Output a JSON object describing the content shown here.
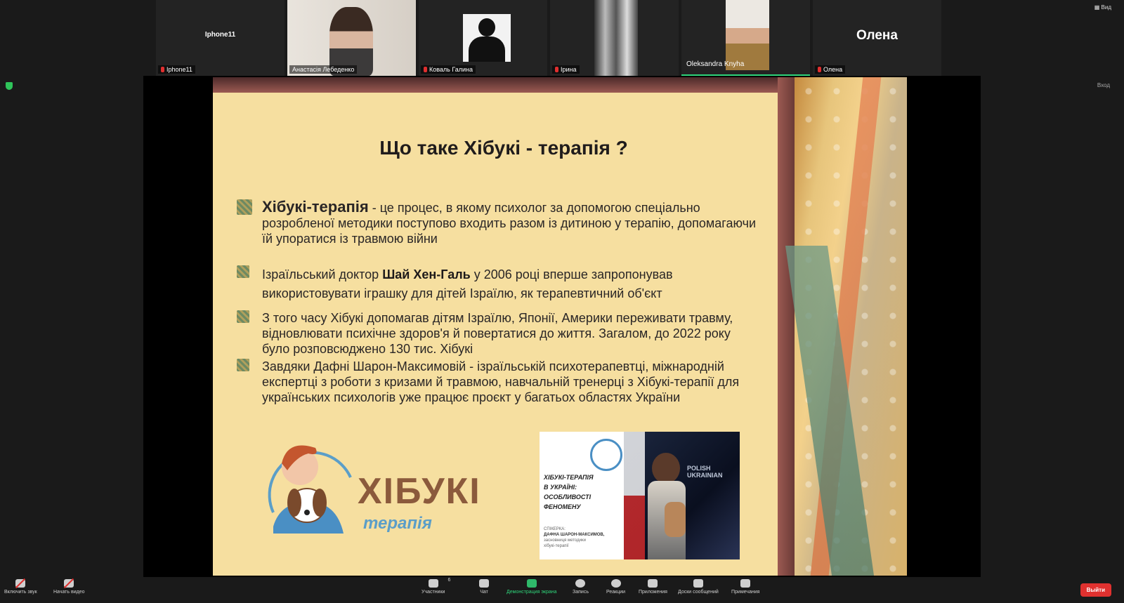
{
  "top_right": {
    "view_label": "Вид",
    "enter_label": "Вход"
  },
  "participants": [
    {
      "center_name": "Iphone11",
      "label": "Iphone11"
    },
    {
      "label": "Анастасія Лебеденко"
    },
    {
      "label": "Коваль Галина"
    },
    {
      "label": "Ірина"
    },
    {
      "label": "Oleksandra Knyha"
    },
    {
      "center_name": "Олена",
      "label": "Олена"
    }
  ],
  "slide": {
    "title": "Що таке Хібукі - терапія ?",
    "b1_term": "Хібукі-терапія",
    "b1_rest": " - це процес, в якому психолог за допомогою спеціально",
    "b1_line2": "розробленої методики поступово входить разом із дитиною у терапію, допомагаючи",
    "b1_line3": "їй упоратися із травмою війни",
    "b2_pre": "Ізраїльський доктор ",
    "b2_name": "Шай Хен-Галь",
    "b2_post": "  у 2006 році вперше  запропонував",
    "b2_line2": "використовувати іграшку для дітей Ізраїлю, як терапевтичний об'єкт",
    "b3_line1": "З того часу Хібукі допомагав дітям Ізраїлю, Японії, Америки переживати травму,",
    "b3_line2": "відновлювати психічне здоров'я й повертатися до життя. Загалом, до 2022 року",
    "b3_line3": "було розповсюджено 130 тис. Хібукі",
    "b4_line1": "Завдяки Дафні Шарон-Максимовій - ізраїльській психотерапевтці, міжнародній",
    "b4_line2": "експертці з роботи з кризами й травмою, навчальній тренерці з Хібукі-терапії для",
    "b4_line3": "українських психологів уже працює проєкт у багатьох областях України",
    "logo_word": "ХІБУКІ",
    "logo_sub": "терапія",
    "photo_title_1": "ХІБУКІ-ТЕРАПІЯ",
    "photo_title_2": "В УКРАЇНІ:",
    "photo_title_3": "ОСОБЛИВОСТІ",
    "photo_title_4": "ФЕНОМЕНУ",
    "photo_speaker_label": "СПІКЕРКА:",
    "photo_speaker_name": "ДАФНА ШАРОН-МАКСИМОВ,",
    "photo_speaker_desc1": "засновниця методики",
    "photo_speaker_desc2": "хібукі-терапії",
    "photo_backdrop": "POLISH UKRAINIAN"
  },
  "toolbar": {
    "audio": "Включить звук",
    "video": "Начать видео",
    "participants": "Участники",
    "participants_count": "6",
    "chat": "Чат",
    "share": "Демонстрация экрана",
    "record": "Запись",
    "reactions": "Реакции",
    "apps": "Приложения",
    "whiteboards": "Доски сообщений",
    "notes": "Примечания",
    "exit": "Выйти"
  },
  "colors": {
    "accent_green": "#2fb96a",
    "exit_red": "#e0312f",
    "slide_bg": "#f6dfa0"
  }
}
